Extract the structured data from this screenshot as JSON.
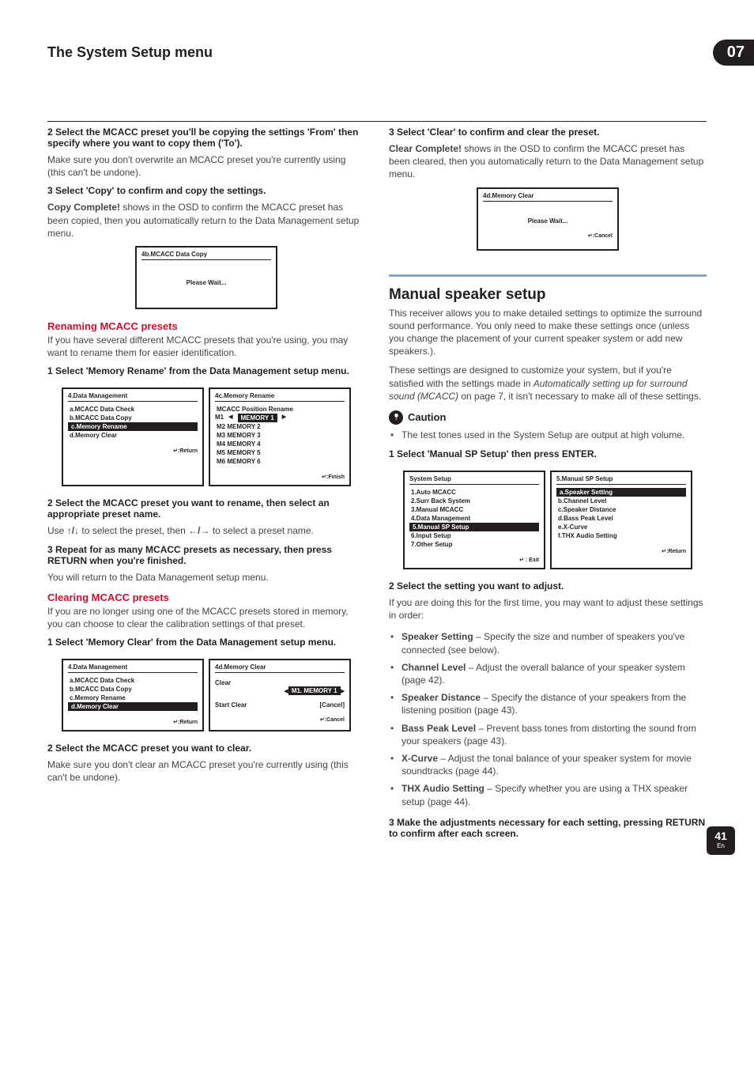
{
  "header": {
    "title": "The System Setup menu",
    "chapter": "07"
  },
  "left": {
    "step2": "2   Select the MCACC preset you'll be copying the settings 'From' then specify where you want to copy them ('To').",
    "step2_body": "Make sure you don't overwrite an MCACC preset you're currently using (this can't be undone).",
    "step3": "3   Select 'Copy' to confirm and copy the settings.",
    "step3_body": "Copy Complete! shows in the OSD to confirm the MCACC preset has been copied, then you automatically return to the Data Management setup menu.",
    "osd_copy": {
      "title": "4b.MCACC Data Copy",
      "msg": "Please Wait..."
    },
    "rename_head": "Renaming MCACC presets",
    "rename_intro": "If you have several different MCACC presets that you're using, you may want to rename them for easier identification.",
    "rename_step1": "1   Select 'Memory Rename' from the Data Management setup menu.",
    "osd_dm": {
      "title": "4.Data Management",
      "items": [
        "a.MCACC Data Check",
        "b.MCACC Data Copy",
        "c.Memory Rename",
        "d.Memory Clear"
      ],
      "foot": ":Return"
    },
    "osd_memren": {
      "title": "4c.Memory Rename",
      "subtitle": "MCACC Position Rename",
      "rows": [
        "M1  MEMORY 1",
        "M2  MEMORY 2",
        "M3  MEMORY 3",
        "M4  MEMORY 4",
        "M5  MEMORY 5",
        "M6  MEMORY 6"
      ],
      "foot": ":Finish"
    },
    "rename_step2": "2   Select the MCACC preset you want to rename, then select an appropriate preset name.",
    "rename_step2_body_a": "Use ",
    "rename_step2_body_b": " to select the preset, then ",
    "rename_step2_body_c": " to select a preset name.",
    "rename_step3": "3   Repeat for as many MCACC presets as necessary, then press RETURN when you're finished.",
    "rename_step3_body": "You will return to the Data Management setup menu.",
    "clear_head": "Clearing MCACC presets",
    "clear_intro": "If you are no longer using one of the MCACC presets stored in memory, you can choose to clear the calibration settings of that preset.",
    "clear_step1": "1   Select 'Memory Clear' from the Data Management setup menu.",
    "osd_dm2": {
      "title": "4.Data Management",
      "items": [
        "a.MCACC Data Check",
        "b.MCACC Data Copy",
        "c.Memory Rename",
        "d.Memory Clear"
      ],
      "foot": ":Return"
    },
    "osd_memclr": {
      "title": "4d.Memory Clear",
      "line1": "Clear",
      "sel": "M1. MEMORY 1",
      "line2a": "Start Clear",
      "line2b": "[Cancel]",
      "foot": ":Cancel"
    },
    "clear_step2": "2   Select the MCACC preset you want to clear.",
    "clear_step2_body": "Make sure you don't clear an MCACC preset you're currently using (this can't be undone)."
  },
  "right": {
    "step3": "3   Select 'Clear' to confirm and clear the preset.",
    "step3_body": "Clear Complete! shows in the OSD to confirm the MCACC preset has been cleared, then you automatically return to the Data Management setup menu.",
    "osd_clr": {
      "title": "4d.Memory Clear",
      "msg": "Please Wait...",
      "foot": ":Cancel"
    },
    "mss_head": "Manual speaker setup",
    "mss_intro1": "This receiver allows you to make detailed settings to optimize the surround sound performance. You only need to make these settings once (unless you change the placement of your current speaker system or add new speakers.).",
    "mss_intro2a": "These settings are designed to customize your system, but if you're satisfied with the settings made in ",
    "mss_intro2b": "Automatically setting up for surround sound (MCACC)",
    "mss_intro2c": " on page 7, it isn't necessary to make all of these settings.",
    "caution": "Caution",
    "caution_bullet": "The test tones used in the System Setup are output at high volume.",
    "mss_step1": "1   Select 'Manual SP Setup' then press ENTER.",
    "osd_sys": {
      "title": "System Setup",
      "items": [
        "1.Auto MCACC",
        "2.Surr Back System",
        "3.Manual MCACC",
        "4.Data Management",
        "5.Manual SP Setup",
        "6.Input Setup",
        "7.Other Setup"
      ],
      "foot": " : Exit"
    },
    "osd_msp": {
      "title": "5.Manual SP Setup",
      "items": [
        "a.Speaker Setting",
        "b.Channel Level",
        "c.Speaker Distance",
        "d.Bass Peak Level",
        "e.X-Curve",
        "f.THX Audio Setting"
      ],
      "foot": ":Return"
    },
    "mss_step2": "2   Select the setting you want to adjust.",
    "mss_step2_body": "If you are doing this for the first time, you may want to adjust these settings in order:",
    "bullets": [
      {
        "b": "Speaker Setting",
        "t": " – Specify the size and number of speakers you've connected (see below)."
      },
      {
        "b": "Channel Level",
        "t": " – Adjust the overall balance of your speaker system (page 42)."
      },
      {
        "b": "Speaker Distance",
        "t": " – Specify the distance of your speakers from the listening position (page 43)."
      },
      {
        "b": "Bass Peak Level",
        "t": " – Prevent bass tones from distorting the sound from your speakers (page 43)."
      },
      {
        "b": "X-Curve",
        "t": " – Adjust the tonal balance of your speaker system for movie soundtracks (page 44)."
      },
      {
        "b": "THX Audio Setting",
        "t": " – Specify whether you are using a THX speaker setup (page 44)."
      }
    ],
    "mss_step3": "3   Make the adjustments necessary for each setting, pressing RETURN to confirm after each screen."
  },
  "footer": {
    "page": "41",
    "lang": "En"
  }
}
